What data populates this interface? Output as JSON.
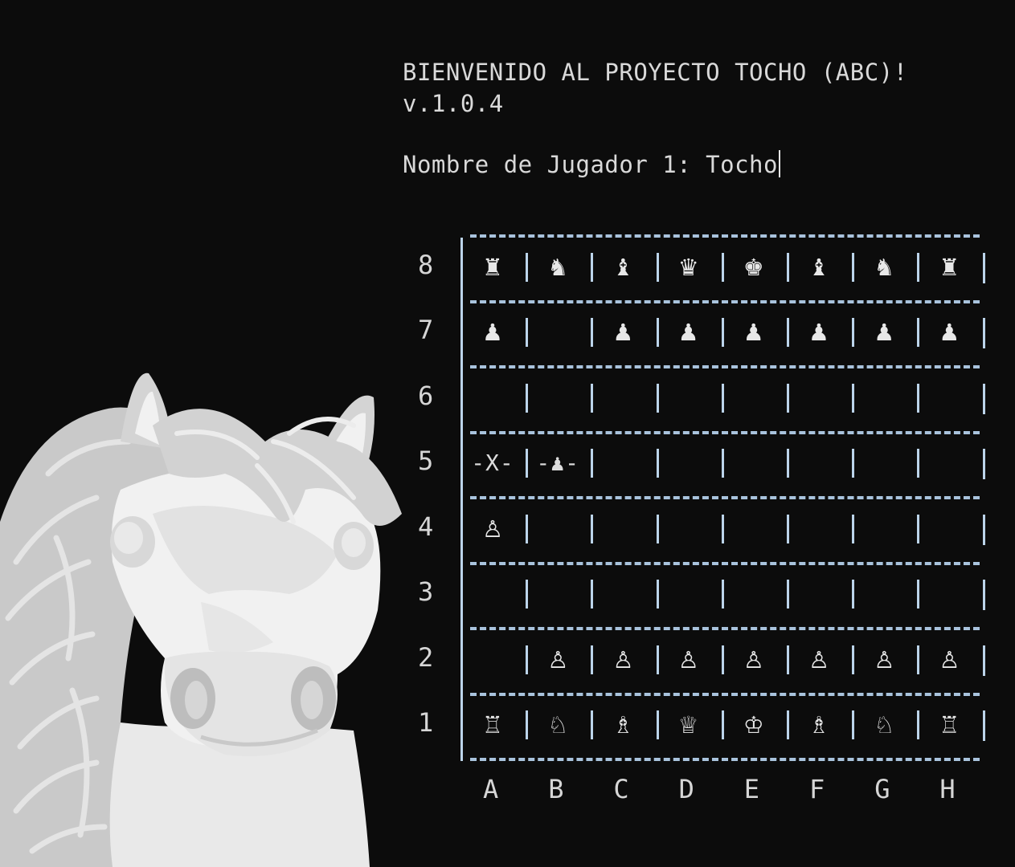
{
  "header": {
    "title": "BIENVENIDO AL PROYECTO TOCHO (ABC)!",
    "version": "v.1.0.4",
    "prompt_label": "Nombre de Jugador 1: ",
    "prompt_value": "Tocho"
  },
  "board": {
    "files": [
      "A",
      "B",
      "C",
      "D",
      "E",
      "F",
      "G",
      "H"
    ],
    "ranks": [
      "8",
      "7",
      "6",
      "5",
      "4",
      "3",
      "2",
      "1"
    ],
    "cells": [
      [
        "♜",
        "♞",
        "♝",
        "♛",
        "♚",
        "♝",
        "♞",
        "♜"
      ],
      [
        "♟",
        "",
        "♟",
        "♟",
        "♟",
        "♟",
        "♟",
        "♟"
      ],
      [
        "",
        "",
        "",
        "",
        "",
        "",
        "",
        ""
      ],
      [
        "-X-",
        "-♟-",
        "",
        "",
        "",
        "",
        "",
        ""
      ],
      [
        "♙",
        "",
        "",
        "",
        "",
        "",
        "",
        ""
      ],
      [
        "",
        "",
        "",
        "",
        "",
        "",
        "",
        ""
      ],
      [
        "",
        "♙",
        "♙",
        "♙",
        "♙",
        "♙",
        "♙",
        "♙"
      ],
      [
        "♖",
        "♘",
        "♗",
        "♕",
        "♔",
        "♗",
        "♘",
        "♖"
      ]
    ]
  },
  "colors": {
    "background": "#0c0c0c",
    "text": "#d9d9d9",
    "grid": "#bcd4ea"
  },
  "illustration": {
    "icon": "horse-head-illustration"
  }
}
